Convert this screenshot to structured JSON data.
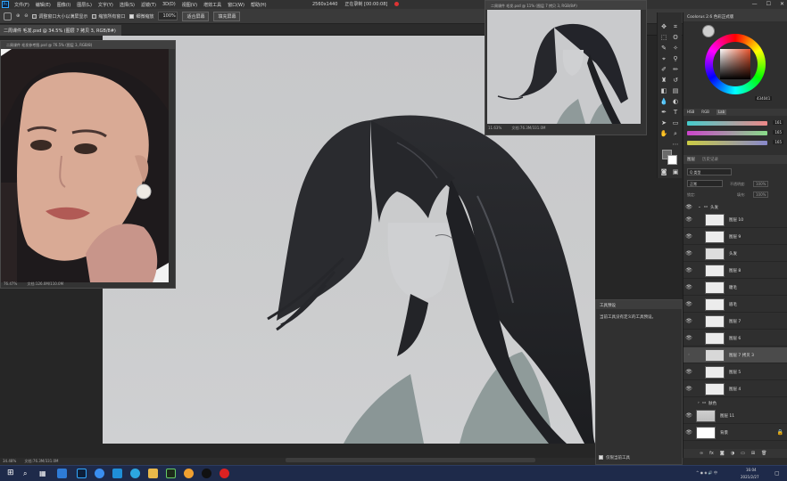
{
  "menubar": {
    "logo": "Ps",
    "items": [
      "文件(F)",
      "编辑(E)",
      "图像(I)",
      "图层(L)",
      "文字(Y)",
      "选择(S)",
      "滤镜(T)",
      "3D(D)",
      "视图(V)",
      "增效工具",
      "窗口(W)",
      "帮助(H)"
    ],
    "resolution": "2560x1440",
    "recording": "正在录制 [00:00:08]"
  },
  "options": {
    "resize_label": "调整窗口大小以满屏显示",
    "zoom_all_label": "缩放所有窗口",
    "scrubby_label": "细微缩放",
    "zoom_value": "100%",
    "fit_label": "适合屏幕",
    "fill_label": "填充屏幕"
  },
  "document": {
    "tab_title": "二周课件 毛发.psd @ 34.5% (图层 7 拷贝 3, RGB/8#)",
    "zoom_status": "34.48%",
    "doc_status": "文档:76.3M/331.0M"
  },
  "reference_window": {
    "title": "二周课件 毛发参考图.psd @ 76.5% (图层 3, RGB/8)",
    "zoom": "76.47%",
    "doc": "文档:126.0M/110.0M"
  },
  "navigator_window": {
    "title": "二周课件 毛发.psd @ 11% (图层 7 拷贝 3, RGB/8#)",
    "zoom": "11.63%",
    "doc": "文档:76.3M/331.0M"
  },
  "color_panel": {
    "tabs": [
      "Coolorus 2.6 色彩正式版"
    ],
    "hex": "434041",
    "slider_tabs": [
      "HSB",
      "RGB",
      "Lab"
    ],
    "rgb_values": [
      "161",
      "165",
      "165"
    ]
  },
  "layers_panel": {
    "tabs": [
      "图层",
      "历史记录"
    ],
    "filter_label": "Q 类型",
    "mode": "正常",
    "opacity_label": "不透明度:",
    "opacity": "100%",
    "lock_label": "锁定:",
    "fill_label": "填充:",
    "fill": "100%",
    "group_name": "头发",
    "layers": [
      {
        "name": "图层 10"
      },
      {
        "name": "图层 9"
      },
      {
        "name": "头发"
      },
      {
        "name": "图层 8"
      },
      {
        "name": "睫毛"
      },
      {
        "name": "眉毛"
      },
      {
        "name": "图层 7"
      },
      {
        "name": "图层 6"
      },
      {
        "name": "图层 7 拷贝 3"
      },
      {
        "name": "图层 5"
      },
      {
        "name": "图层 4"
      }
    ],
    "group2_name": "肤色",
    "bottom_layers": [
      {
        "name": "图层 11"
      },
      {
        "name": "背景"
      }
    ]
  },
  "properties_panel": {
    "title": "工具预设",
    "message": "当前工具没有定义的工具预设。",
    "footer": "仅限当前工具"
  },
  "taskbar": {
    "clock": "16:04",
    "date": "2021/2/27"
  }
}
